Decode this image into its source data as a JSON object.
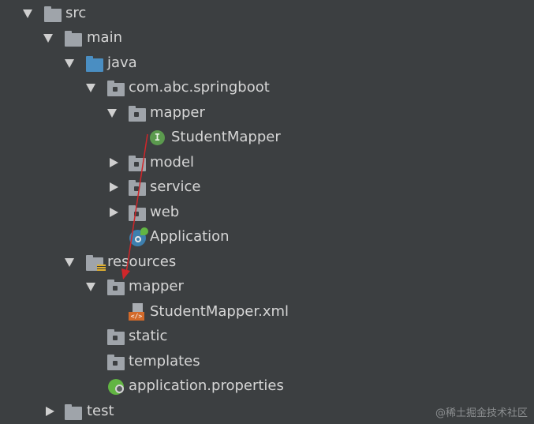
{
  "tree": {
    "src": "src",
    "main": "main",
    "java": "java",
    "package": "com.abc.springboot",
    "mapper_pkg": "mapper",
    "student_mapper": "StudentMapper",
    "model": "model",
    "service": "service",
    "web": "web",
    "application": "Application",
    "resources": "resources",
    "res_mapper": "mapper",
    "mapper_xml": "StudentMapper.xml",
    "static": "static",
    "templates": "templates",
    "app_props": "application.properties",
    "test": "test"
  },
  "watermark": "@稀土掘金技术社区",
  "colors": {
    "background": "#3c3f41",
    "arrow_annotation": "#d0262a"
  }
}
